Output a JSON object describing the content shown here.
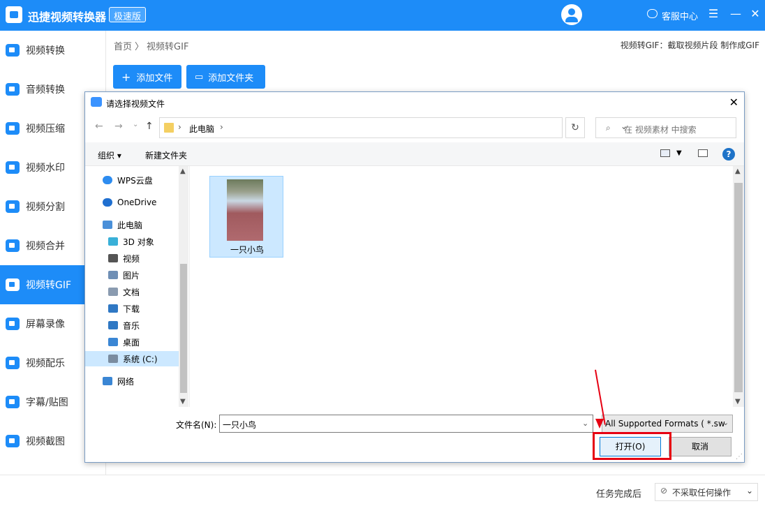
{
  "app": {
    "title": "迅捷视频转换器",
    "badge": "极速版",
    "service": "客服中心"
  },
  "window": {
    "menu": "☰",
    "minimize": "—",
    "close": "✕"
  },
  "sidebar": {
    "items": [
      {
        "label": "视频转换"
      },
      {
        "label": "音频转换"
      },
      {
        "label": "视频压缩"
      },
      {
        "label": "视频水印"
      },
      {
        "label": "视频分割"
      },
      {
        "label": "视频合并"
      },
      {
        "label": "视频转GIF",
        "active": true
      },
      {
        "label": "屏幕录像"
      },
      {
        "label": "视频配乐"
      },
      {
        "label": "字幕/贴图"
      },
      {
        "label": "视频截图"
      }
    ]
  },
  "breadcrumb": {
    "home": "首页",
    "sep": "〉",
    "current": "视频转GIF"
  },
  "hint": "视频转GIF：截取视频片段 制作成GIF",
  "toolbar": {
    "add_file": "添加文件",
    "add_folder": "添加文件夹"
  },
  "bottom": {
    "label": "任务完成后",
    "select": "不采取任何操作"
  },
  "dialog": {
    "title": "请选择视频文件",
    "close": "✕",
    "address": "此电脑",
    "search_placeholder": "在 视频素材 中搜索",
    "organize": "组织 ▾",
    "new_folder": "新建文件夹",
    "help": "?",
    "nav": [
      {
        "label": "WPS云盘",
        "color": "#2d8cf0"
      },
      {
        "label": "OneDrive",
        "color": "#1f6fd0"
      },
      {
        "label": "此电脑",
        "color": "#4a90d9"
      },
      {
        "label": "3D 对象",
        "color": "#39b0d8"
      },
      {
        "label": "视频",
        "color": "#555555"
      },
      {
        "label": "图片",
        "color": "#6f8fb5"
      },
      {
        "label": "文档",
        "color": "#8a9bb0"
      },
      {
        "label": "下载",
        "color": "#2f78c4"
      },
      {
        "label": "音乐",
        "color": "#2f78c4"
      },
      {
        "label": "桌面",
        "color": "#3a86d4"
      },
      {
        "label": "系统 (C:)",
        "color": "#7a8ca0",
        "selected": true
      },
      {
        "label": "网络",
        "color": "#3a86d4"
      }
    ],
    "file": {
      "name": "一只小鸟"
    },
    "filename_label": "文件名(N):",
    "filename_value": "一只小鸟",
    "filetype": "All Supported Formats ( *.sw",
    "open": "打开(O)",
    "cancel": "取消"
  },
  "colors": {
    "accent": "#1d8cf8",
    "highlight": "#e60012"
  }
}
